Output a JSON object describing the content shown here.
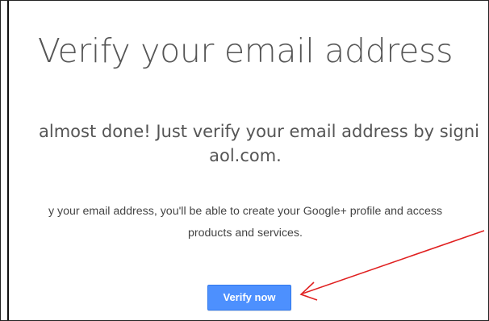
{
  "page": {
    "title": "Verify your email address",
    "subtitle_line1": "almost done! Just verify your email address by signi",
    "subtitle_line2": "aol.com.",
    "body_line1": "y your email address, you'll be able to create your Google+ profile and access",
    "body_line2": "products and services."
  },
  "actions": {
    "verify_label": "Verify now"
  },
  "colors": {
    "button_blue": "#4d90fe",
    "annotation_arrow": "#e02020",
    "heading_text": "#555555"
  },
  "icons": {
    "annotation": "red-arrow-icon"
  }
}
